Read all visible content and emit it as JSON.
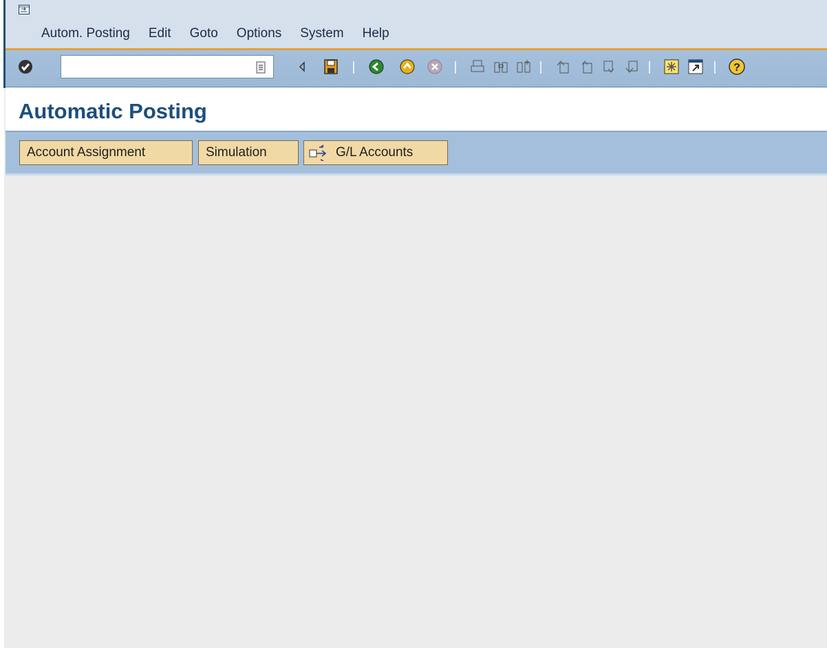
{
  "menubar": {
    "items": [
      {
        "label": "Autom. Posting"
      },
      {
        "label": "Edit"
      },
      {
        "label": "Goto"
      },
      {
        "label": "Options"
      },
      {
        "label": "System"
      },
      {
        "label": "Help"
      }
    ]
  },
  "toolbar": {
    "command_field_value": "",
    "icons": [
      "enter-icon",
      "command-field-dropdown-icon",
      "collapse-arrow-icon",
      "save-icon",
      "back-icon",
      "exit-icon",
      "cancel-icon",
      "print-icon",
      "find-icon",
      "find-next-icon",
      "first-page-icon",
      "previous-page-icon",
      "next-page-icon",
      "last-page-icon",
      "create-session-icon",
      "shortcut-icon",
      "help-icon"
    ]
  },
  "title": {
    "text": "Automatic Posting"
  },
  "app_toolbar": {
    "buttons": [
      {
        "label": "Account Assignment"
      },
      {
        "label": "Simulation"
      },
      {
        "label": "G/L Accounts"
      }
    ]
  },
  "colors": {
    "menubar_bg": "#d6e0ec",
    "toolbar_bg": "#a5c0dc",
    "title_color": "#1d4e7e",
    "button_bg": "#f1d9a5",
    "accent_orange": "#e4a13a",
    "content_bg": "#ececec"
  }
}
